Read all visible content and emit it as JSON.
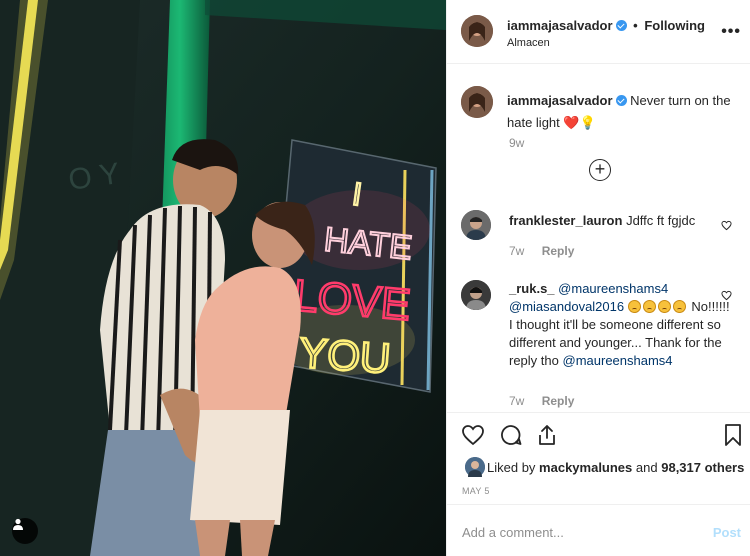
{
  "header": {
    "username": "iammajasalvador",
    "separator": "•",
    "follow_status": "Following",
    "location": "Almacen",
    "more": "•••"
  },
  "caption": {
    "username": "iammajasalvador",
    "text": "Never turn on the hate light",
    "emoji": "❤️💡",
    "time": "9w",
    "load_more": "+"
  },
  "comments": [
    {
      "username": "franklester_lauron",
      "text": "Jdffc ft fgjdc",
      "time": "7w",
      "reply": "Reply"
    },
    {
      "username": "_ruk.s_",
      "mention1": "@maureenshams4",
      "mention2": "@miasandoval2016",
      "text": "No!!!!!! I thought it'll be someone different so different and younger... Thank for the reply tho",
      "mention3": "@maureenshams4",
      "time": "7w",
      "reply": "Reply"
    }
  ],
  "likes": {
    "prefix": "Liked by",
    "user": "mackymalunes",
    "middle": "and",
    "count": "98,317 others"
  },
  "date": "MAY 5",
  "add_comment": {
    "placeholder": "Add a comment...",
    "post": "Post"
  },
  "neon": {
    "line1": "I",
    "line2": "HATE",
    "line3": "LOVE",
    "line4": "YOU"
  },
  "colors": {
    "verified": "#3897f0",
    "link": "#003569",
    "post_disabled": "#b2dffc",
    "muted": "#8e8e8e"
  }
}
